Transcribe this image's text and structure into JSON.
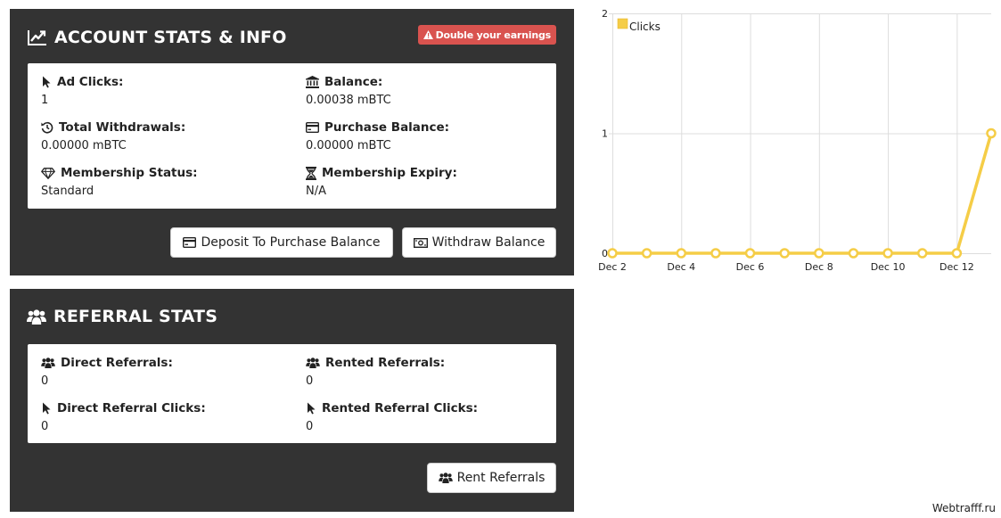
{
  "account": {
    "title": "ACCOUNT STATS & INFO",
    "badge": "Double your earnings",
    "stats": [
      {
        "label": "Ad Clicks:",
        "value": "1",
        "icon": "cursor-icon"
      },
      {
        "label": "Balance:",
        "value": "0.00038 mBTC",
        "icon": "bank-icon"
      },
      {
        "label": "Total Withdrawals:",
        "value": "0.00000 mBTC",
        "icon": "history-icon"
      },
      {
        "label": "Purchase Balance:",
        "value": "0.00000 mBTC",
        "icon": "credit-card-icon"
      },
      {
        "label": "Membership Status:",
        "value": "Standard",
        "icon": "diamond-icon"
      },
      {
        "label": "Membership Expiry:",
        "value": "N/A",
        "icon": "hourglass-icon"
      }
    ],
    "deposit_label": "Deposit To Purchase Balance",
    "withdraw_label": "Withdraw Balance"
  },
  "referral": {
    "title": "REFERRAL STATS",
    "stats": [
      {
        "label": "Direct Referrals:",
        "value": "0",
        "icon": "users-icon"
      },
      {
        "label": "Rented Referrals:",
        "value": "0",
        "icon": "users-icon"
      },
      {
        "label": "Direct Referral Clicks:",
        "value": "0",
        "icon": "cursor-icon"
      },
      {
        "label": "Rented Referral Clicks:",
        "value": "0",
        "icon": "cursor-icon"
      }
    ],
    "rent_label": "Rent Referrals"
  },
  "chart_data": {
    "type": "line",
    "x": [
      "Dec 2",
      "Dec 3",
      "Dec 4",
      "Dec 5",
      "Dec 6",
      "Dec 7",
      "Dec 8",
      "Dec 9",
      "Dec 10",
      "Dec 11",
      "Dec 12",
      "Dec 13"
    ],
    "x_tick_labels": [
      "Dec 2",
      "Dec 4",
      "Dec 6",
      "Dec 8",
      "Dec 10",
      "Dec 12"
    ],
    "series": [
      {
        "name": "Clicks",
        "values": [
          0,
          0,
          0,
          0,
          0,
          0,
          0,
          0,
          0,
          0,
          0,
          1
        ],
        "color": "#f5cd47"
      }
    ],
    "y_ticks": [
      "0",
      "1",
      "2"
    ],
    "ylim": [
      0,
      2
    ],
    "grid": true,
    "legend": "top-left"
  },
  "watermark": "Webtrafff.ru"
}
